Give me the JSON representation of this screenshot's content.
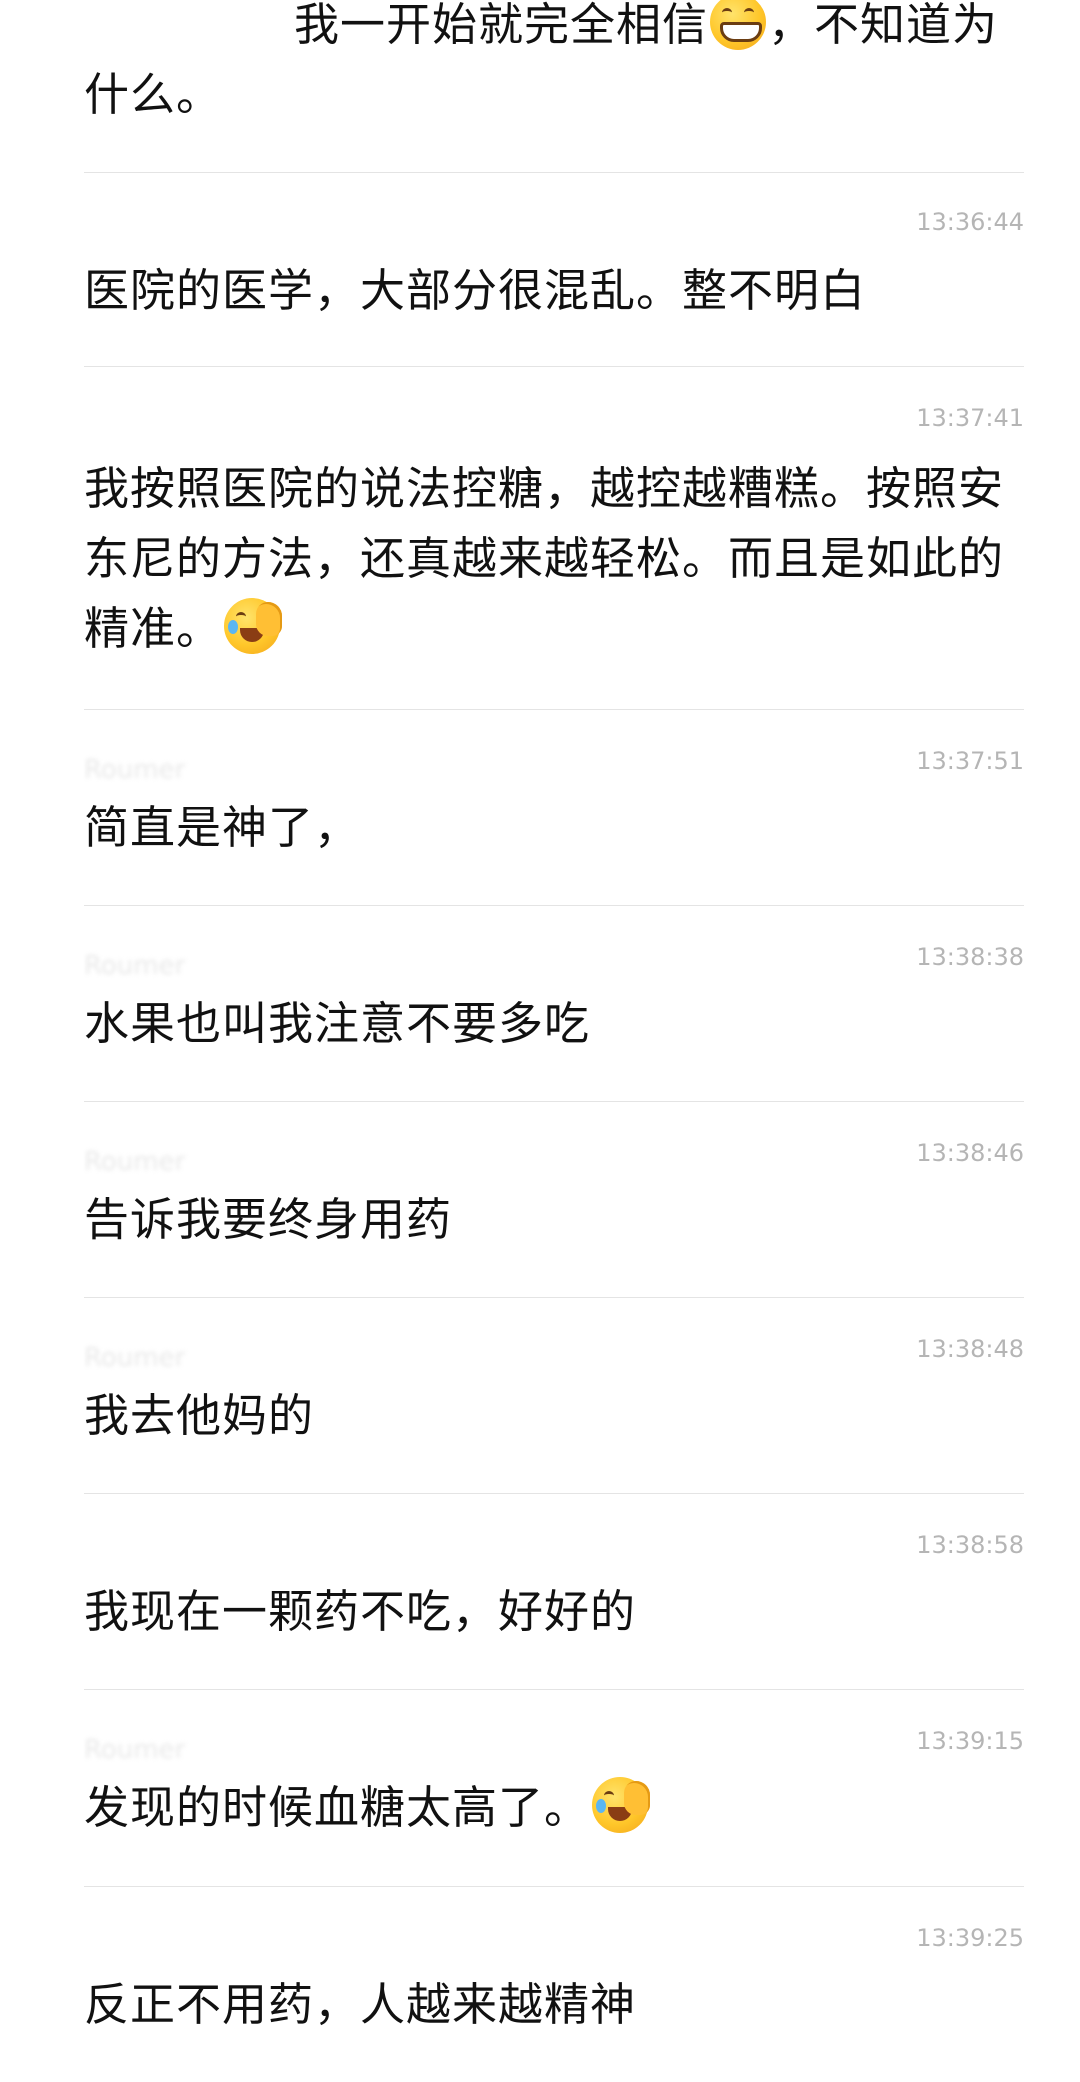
{
  "messages": [
    {
      "sender": "",
      "time": "",
      "text_before": "我一开始就完全相信",
      "emoji": "grinning-emoji",
      "text_after": "，不知道为什么。"
    },
    {
      "sender": "",
      "time": "13:36:44",
      "text": "医院的医学，大部分很混乱。整不明白"
    },
    {
      "sender": "",
      "time": "13:37:41",
      "text": "我按照医院的说法控糖，越控越糟糕。按照安东尼的方法，还真越来越轻松。而且是如此的精准。",
      "emoji": "facepalm-laugh-emoji"
    },
    {
      "sender": "Roumer",
      "time": "13:37:51",
      "text": "简直是神了，"
    },
    {
      "sender": "Roumer",
      "time": "13:38:38",
      "text": "水果也叫我注意不要多吃"
    },
    {
      "sender": "Roumer",
      "time": "13:38:46",
      "text": "告诉我要终身用药"
    },
    {
      "sender": "Roumer",
      "time": "13:38:48",
      "text": "我去他妈的"
    },
    {
      "sender": "",
      "time": "13:38:58",
      "text": "我现在一颗药不吃，好好的"
    },
    {
      "sender": "Roumer",
      "time": "13:39:15",
      "text": "发现的时候血糖太高了。",
      "emoji": "facepalm-laugh-emoji"
    },
    {
      "sender": "",
      "time": "13:39:25",
      "text": "反正不用药，人越来越精神"
    }
  ]
}
